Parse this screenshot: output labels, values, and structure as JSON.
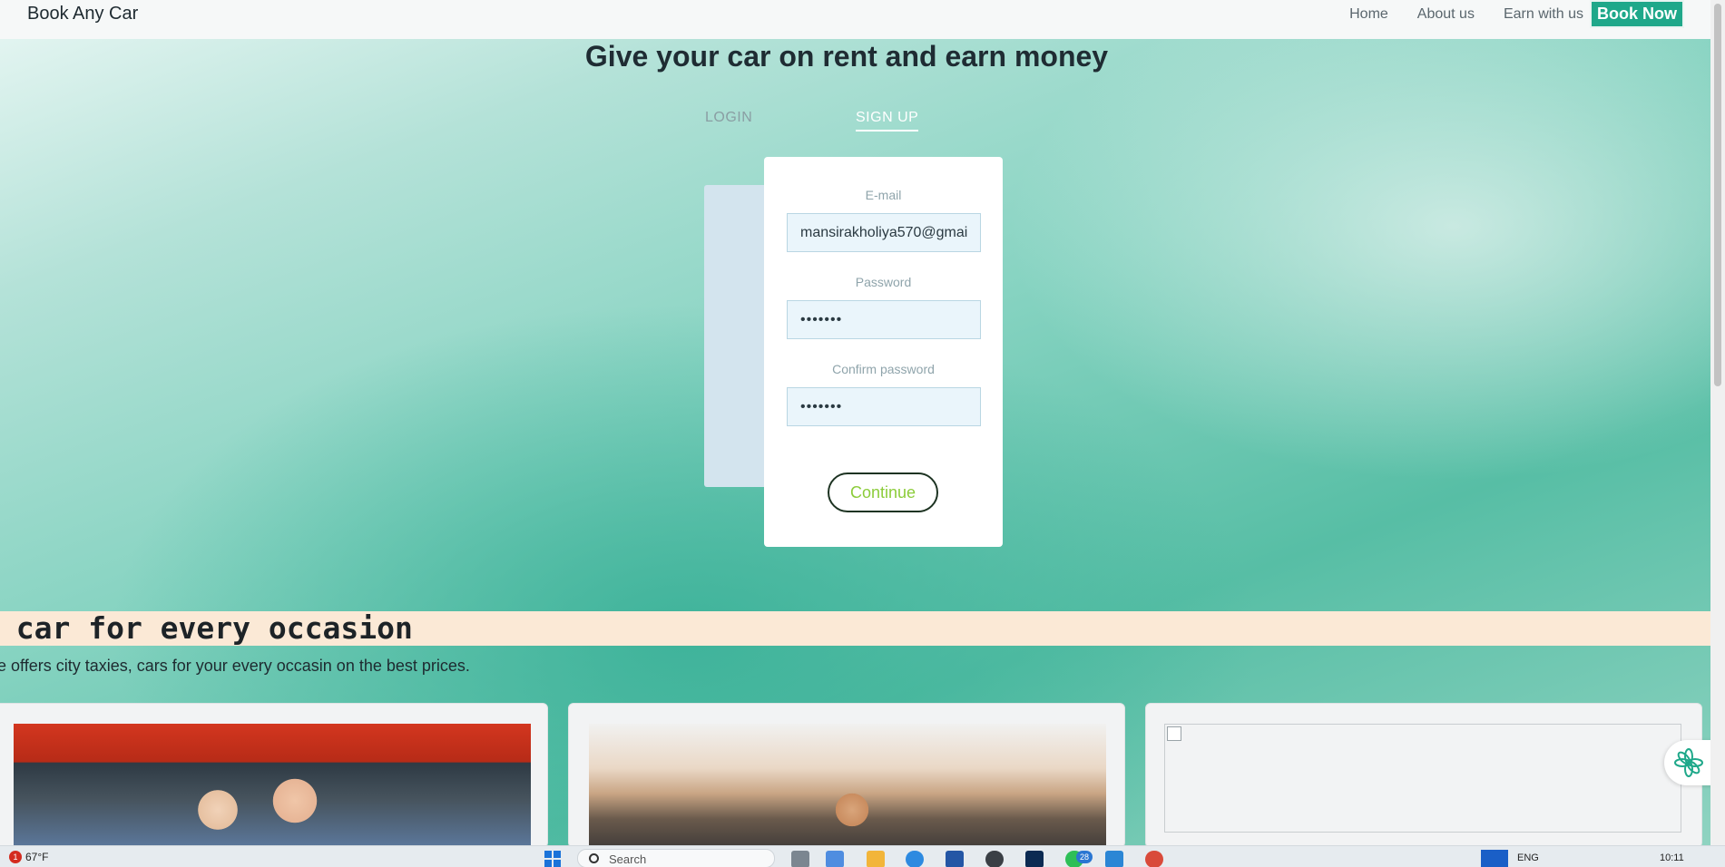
{
  "navbar": {
    "brand": "Book Any Car",
    "links": [
      "Home",
      "About us",
      "Earn with us"
    ],
    "book_now": "Book Now"
  },
  "hero": {
    "title": "Give your car on rent and earn money"
  },
  "tabs": {
    "login": "LOGIN",
    "signup": "SIGN UP",
    "active": "SIGN UP"
  },
  "signup_form": {
    "email_label": "E-mail",
    "email_value": "mansirakholiya570@gmai",
    "password_label": "Password",
    "password_value": "•••••••",
    "confirm_label": "Confirm password",
    "confirm_value": "•••••••",
    "continue": "Continue"
  },
  "occasion": {
    "title": "a car for every occasion",
    "description": "e offers city taxies, cars for your every occasin on the best prices."
  },
  "taskbar": {
    "weather_temp": "67°F",
    "weather_badge": "1",
    "search_placeholder": "Search",
    "app_badge": "28",
    "language": "ENG",
    "time": "10:11"
  },
  "colors": {
    "accent": "#1fa88a",
    "continue_text": "#8ccc3a",
    "occasion_band": "#fbe9d6"
  }
}
